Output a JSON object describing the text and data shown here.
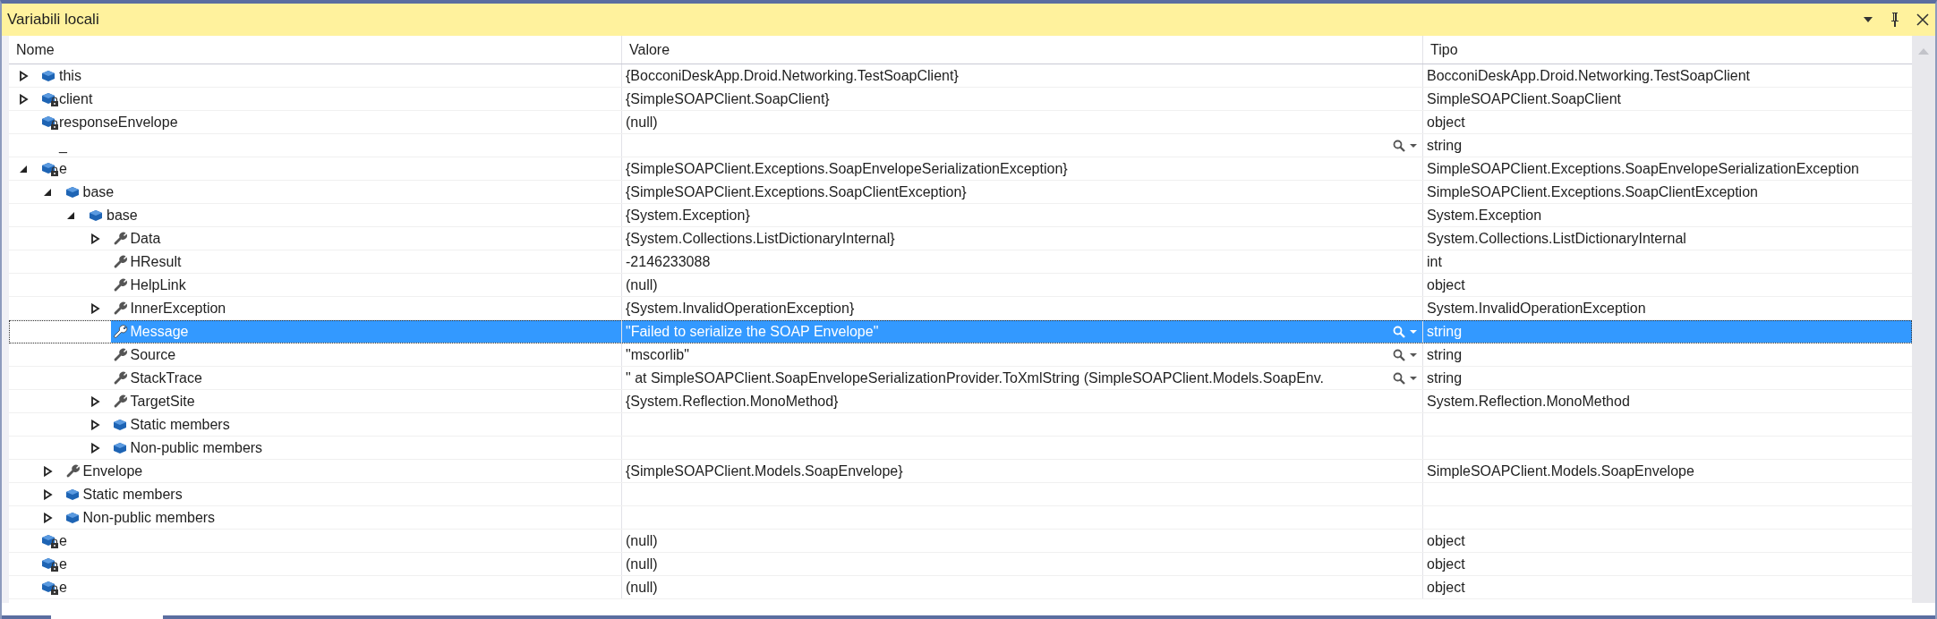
{
  "window": {
    "title": "Variabili locali"
  },
  "table": {
    "columns": [
      "Nome",
      "Valore",
      "Tipo"
    ],
    "rows": [
      {
        "name": "this",
        "value": "{BocconiDeskApp.Droid.Networking.TestSoapClient}",
        "type": "BocconiDeskApp.Droid.Networking.TestSoapClient",
        "kind": "object",
        "expanded": false,
        "selected": false
      },
      {
        "name": "client",
        "value": "{SimpleSOAPClient.SoapClient}",
        "type": "SimpleSOAPClient.SoapClient",
        "kind": "private",
        "expanded": false,
        "selected": false
      },
      {
        "name": "responseEnvelope",
        "value": "(null)",
        "type": "object",
        "kind": "private",
        "selected": false
      },
      {
        "name": "_",
        "type": "string",
        "kind": "plain",
        "visualizer": true,
        "selected": false
      },
      {
        "name": "e",
        "value": "{SimpleSOAPClient.Exceptions.SoapEnvelopeSerializationException}",
        "type": "SimpleSOAPClient.Exceptions.SoapEnvelopeSerializationException",
        "kind": "private",
        "expanded": true,
        "selected": false,
        "children": [
          {
            "name": "base",
            "value": "{SimpleSOAPClient.Exceptions.SoapClientException}",
            "type": "SimpleSOAPClient.Exceptions.SoapClientException",
            "kind": "object",
            "expanded": true,
            "selected": false,
            "children": [
              {
                "name": "base",
                "value": "{System.Exception}",
                "type": "System.Exception",
                "kind": "object",
                "expanded": true,
                "selected": false,
                "children": [
                  {
                    "name": "Data",
                    "value": "{System.Collections.ListDictionaryInternal}",
                    "type": "System.Collections.ListDictionaryInternal",
                    "kind": "property",
                    "expanded": false,
                    "selected": false
                  },
                  {
                    "name": "HResult",
                    "value": "-2146233088",
                    "type": "int",
                    "kind": "property",
                    "selected": false
                  },
                  {
                    "name": "HelpLink",
                    "value": "(null)",
                    "type": "object",
                    "kind": "property",
                    "selected": false
                  },
                  {
                    "name": "InnerException",
                    "value": "{System.InvalidOperationException}",
                    "type": "System.InvalidOperationException",
                    "kind": "property",
                    "expanded": false,
                    "selected": false
                  },
                  {
                    "name": "Message",
                    "value": "\"Failed to serialize the SOAP Envelope\"",
                    "type": "string",
                    "kind": "property",
                    "visualizer": true,
                    "selected": true
                  },
                  {
                    "name": "Source",
                    "value": "\"mscorlib\"",
                    "type": "string",
                    "kind": "property",
                    "visualizer": true,
                    "selected": false
                  },
                  {
                    "name": "StackTrace",
                    "value": "\"  at SimpleSOAPClient.SoapEnvelopeSerializationProvider.ToXmlString (SimpleSOAPClient.Models.SoapEnv.",
                    "type": "string",
                    "kind": "property",
                    "visualizer": true,
                    "selected": false
                  },
                  {
                    "name": "TargetSite",
                    "value": "{System.Reflection.MonoMethod}",
                    "type": "System.Reflection.MonoMethod",
                    "kind": "property",
                    "expanded": false,
                    "selected": false
                  },
                  {
                    "name": "Static members",
                    "kind": "object",
                    "expanded": false,
                    "selected": false
                  },
                  {
                    "name": "Non-public members",
                    "kind": "object",
                    "expanded": false,
                    "selected": false
                  }
                ]
              }
            ]
          },
          {
            "name": "Envelope",
            "value": "{SimpleSOAPClient.Models.SoapEnvelope}",
            "type": "SimpleSOAPClient.Models.SoapEnvelope",
            "kind": "property",
            "expanded": false,
            "selected": false
          },
          {
            "name": "Static members",
            "kind": "object",
            "expanded": false,
            "selected": false
          },
          {
            "name": "Non-public members",
            "kind": "object",
            "expanded": false,
            "selected": false
          }
        ]
      },
      {
        "name": "e",
        "value": "(null)",
        "type": "object",
        "kind": "private",
        "selected": false
      },
      {
        "name": "e",
        "value": "(null)",
        "type": "object",
        "kind": "private",
        "selected": false
      },
      {
        "name": "e",
        "value": "(null)",
        "type": "object",
        "kind": "private",
        "selected": false
      }
    ]
  }
}
